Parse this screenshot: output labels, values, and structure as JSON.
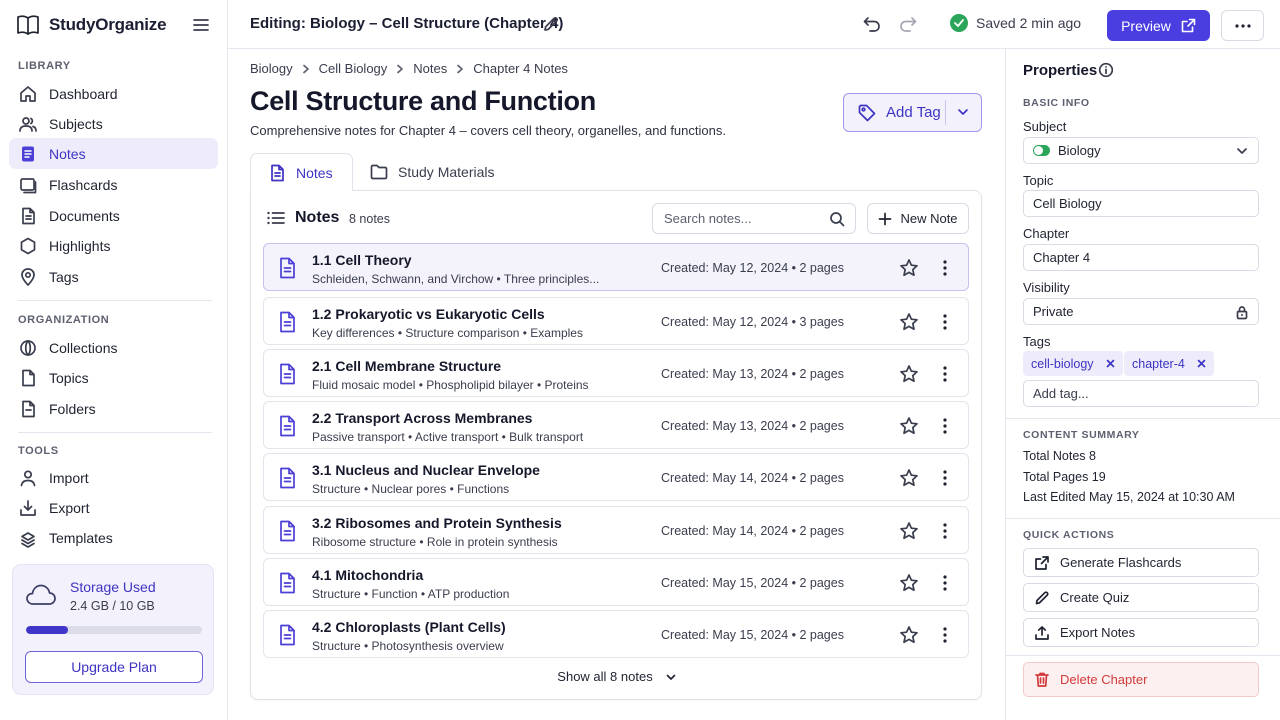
{
  "brand": {
    "name": "StudyOrganize"
  },
  "sidebar": {
    "sections": {
      "library": "LIBRARY",
      "organization": "ORGANIZATION",
      "tools": "TOOLS"
    },
    "library_items": [
      {
        "label": "Dashboard",
        "icon": "home-icon"
      },
      {
        "label": "Subjects",
        "icon": "users-icon"
      },
      {
        "label": "Notes",
        "icon": "notes-icon",
        "active": true
      },
      {
        "label": "Flashcards",
        "icon": "flashcard-icon"
      },
      {
        "label": "Documents",
        "icon": "document-icon"
      },
      {
        "label": "Highlights",
        "icon": "highlight-icon"
      },
      {
        "label": "Tags",
        "icon": "tag-icon"
      }
    ],
    "organization_items": [
      {
        "label": "Collections",
        "icon": "collections-icon"
      },
      {
        "label": "Topics",
        "icon": "topics-icon"
      },
      {
        "label": "Folders",
        "icon": "folder-icon"
      }
    ],
    "tools_items": [
      {
        "label": "Import",
        "icon": "import-icon"
      },
      {
        "label": "Export",
        "icon": "export-icon"
      },
      {
        "label": "Templates",
        "icon": "templates-icon"
      }
    ],
    "storage": {
      "title": "Storage Used",
      "usage": "2.4 GB / 10 GB",
      "fraction": 0.24,
      "upgrade_label": "Upgrade Plan"
    }
  },
  "topbar": {
    "title": "Editing: Biology – Cell Structure (Chapter 4)",
    "saved_status": "Saved 2 min ago",
    "preview_label": "Preview"
  },
  "breadcrumb": [
    "Biology",
    "Cell Biology",
    "Notes",
    "Chapter 4 Notes"
  ],
  "page": {
    "title": "Cell Structure and Function",
    "subtitle": "Comprehensive notes for Chapter 4 – covers cell theory, organelles, and functions.",
    "add_tag_label": "Add Tag"
  },
  "tabs": {
    "notes": "Notes",
    "materials": "Study Materials"
  },
  "notes_panel": {
    "title": "Notes",
    "count": "8 notes",
    "search_placeholder": "Search notes...",
    "new_note_label": "New Note",
    "show_all_label": "Show all 8 notes",
    "items": [
      {
        "title": "1.1 Cell Theory",
        "summary": "Schleiden, Schwann, and Virchow • Three principles...",
        "meta": "Created: May 12, 2024  •  2 pages",
        "starred": true,
        "selected": true
      },
      {
        "title": "1.2 Prokaryotic vs Eukaryotic Cells",
        "summary": "Key differences • Structure comparison • Examples",
        "meta": "Created: May 12, 2024  •  3 pages",
        "starred": false
      },
      {
        "title": "2.1 Cell Membrane Structure",
        "summary": "Fluid mosaic model • Phospholipid bilayer • Proteins",
        "meta": "Created: May 13, 2024  •  2 pages",
        "starred": false
      },
      {
        "title": "2.2 Transport Across Membranes",
        "summary": "Passive transport • Active transport • Bulk transport",
        "meta": "Created: May 13, 2024  •  2 pages",
        "starred": false
      },
      {
        "title": "3.1 Nucleus and Nuclear Envelope",
        "summary": "Structure • Nuclear pores • Functions",
        "meta": "Created: May 14, 2024  •  2 pages",
        "starred": false
      },
      {
        "title": "3.2 Ribosomes and Protein Synthesis",
        "summary": "Ribosome structure • Role in protein synthesis",
        "meta": "Created: May 14, 2024  •  2 pages",
        "starred": false
      },
      {
        "title": "4.1 Mitochondria",
        "summary": "Structure • Function • ATP production",
        "meta": "Created: May 15, 2024  •  2 pages",
        "starred": false
      },
      {
        "title": "4.2 Chloroplasts (Plant Cells)",
        "summary": "Structure • Photosynthesis overview",
        "meta": "Created: May 15, 2024  •  2 pages",
        "starred": false
      }
    ]
  },
  "properties": {
    "title": "Properties",
    "basic_info": "BASIC INFO",
    "subject_label": "Subject",
    "subject_value": "Biology",
    "topic_label": "Topic",
    "topic_value": "Cell Biology",
    "chapter_label": "Chapter",
    "chapter_value": "Chapter 4",
    "visibility_label": "Visibility",
    "visibility_value": "Private",
    "tags_label": "Tags",
    "tags": [
      "cell-biology",
      "chapter-4"
    ],
    "add_tag_placeholder": "Add tag...",
    "content_summary": "CONTENT SUMMARY",
    "total_notes": "Total Notes  8",
    "total_pages": "Total Pages  19",
    "last_edited": "Last Edited May 15, 2024 at 10:30 AM",
    "quick_actions": "QUICK ACTIONS",
    "actions": [
      "Generate Flashcards",
      "Create Quiz",
      "Export Notes"
    ],
    "delete_label": "Delete Chapter"
  },
  "colors": {
    "accent": "#4a3ee0",
    "success": "#2ba559",
    "star": "#f2b81c",
    "danger": "#d33a3a"
  }
}
